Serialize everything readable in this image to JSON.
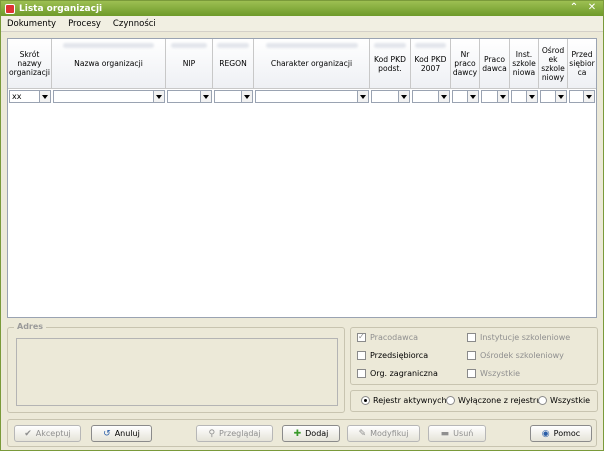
{
  "window": {
    "title": "Lista organizacji",
    "controls": {
      "collapse": "⌃",
      "close": "✕"
    }
  },
  "menu": [
    "Dokumenty",
    "Procesy",
    "Czynności"
  ],
  "grid": {
    "columns": [
      {
        "label": "Skrót nazwy organizacji",
        "filter": "xx"
      },
      {
        "label": "Nazwa organizacji",
        "filter": ""
      },
      {
        "label": "NIP",
        "filter": ""
      },
      {
        "label": "REGON",
        "filter": ""
      },
      {
        "label": "Charakter organizacji",
        "filter": ""
      },
      {
        "label": "Kod PKD podst.",
        "filter": ""
      },
      {
        "label": "Kod PKD 2007",
        "filter": ""
      },
      {
        "label": "Nr praco dawcy",
        "filter": ""
      },
      {
        "label": "Praco dawca",
        "filter": ""
      },
      {
        "label": "Inst. szkole niowa",
        "filter": ""
      },
      {
        "label": "Ośrod ek szkole niowy",
        "filter": ""
      },
      {
        "label": "Przed siębior ca",
        "filter": ""
      }
    ]
  },
  "address": {
    "title": "Adres"
  },
  "flags": {
    "pracodawca": "Pracodawca",
    "instytucje": "Instytucje szkoleniowe",
    "przedsiebiorca": "Przedsiębiorca",
    "osrodek": "Ośrodek szkoleniowy",
    "zagraniczna": "Org. zagraniczna",
    "wszystkie": "Wszystkie"
  },
  "registry": {
    "aktywnych": "Rejestr aktywnych",
    "wylaczone": "Wyłączone z rejestru",
    "wszystkie": "Wszystkie"
  },
  "buttons": {
    "akceptuj": "Akceptuj",
    "anuluj": "Anuluj",
    "przegladaj": "Przeglądaj",
    "dodaj": "Dodaj",
    "modyfikuj": "Modyfikuj",
    "usun": "Usuń",
    "pomoc": "Pomoc"
  },
  "colors": {
    "titlebar": "#7ea63a",
    "add_icon": "#3a9a2a",
    "help_icon": "#2a5ea8"
  }
}
